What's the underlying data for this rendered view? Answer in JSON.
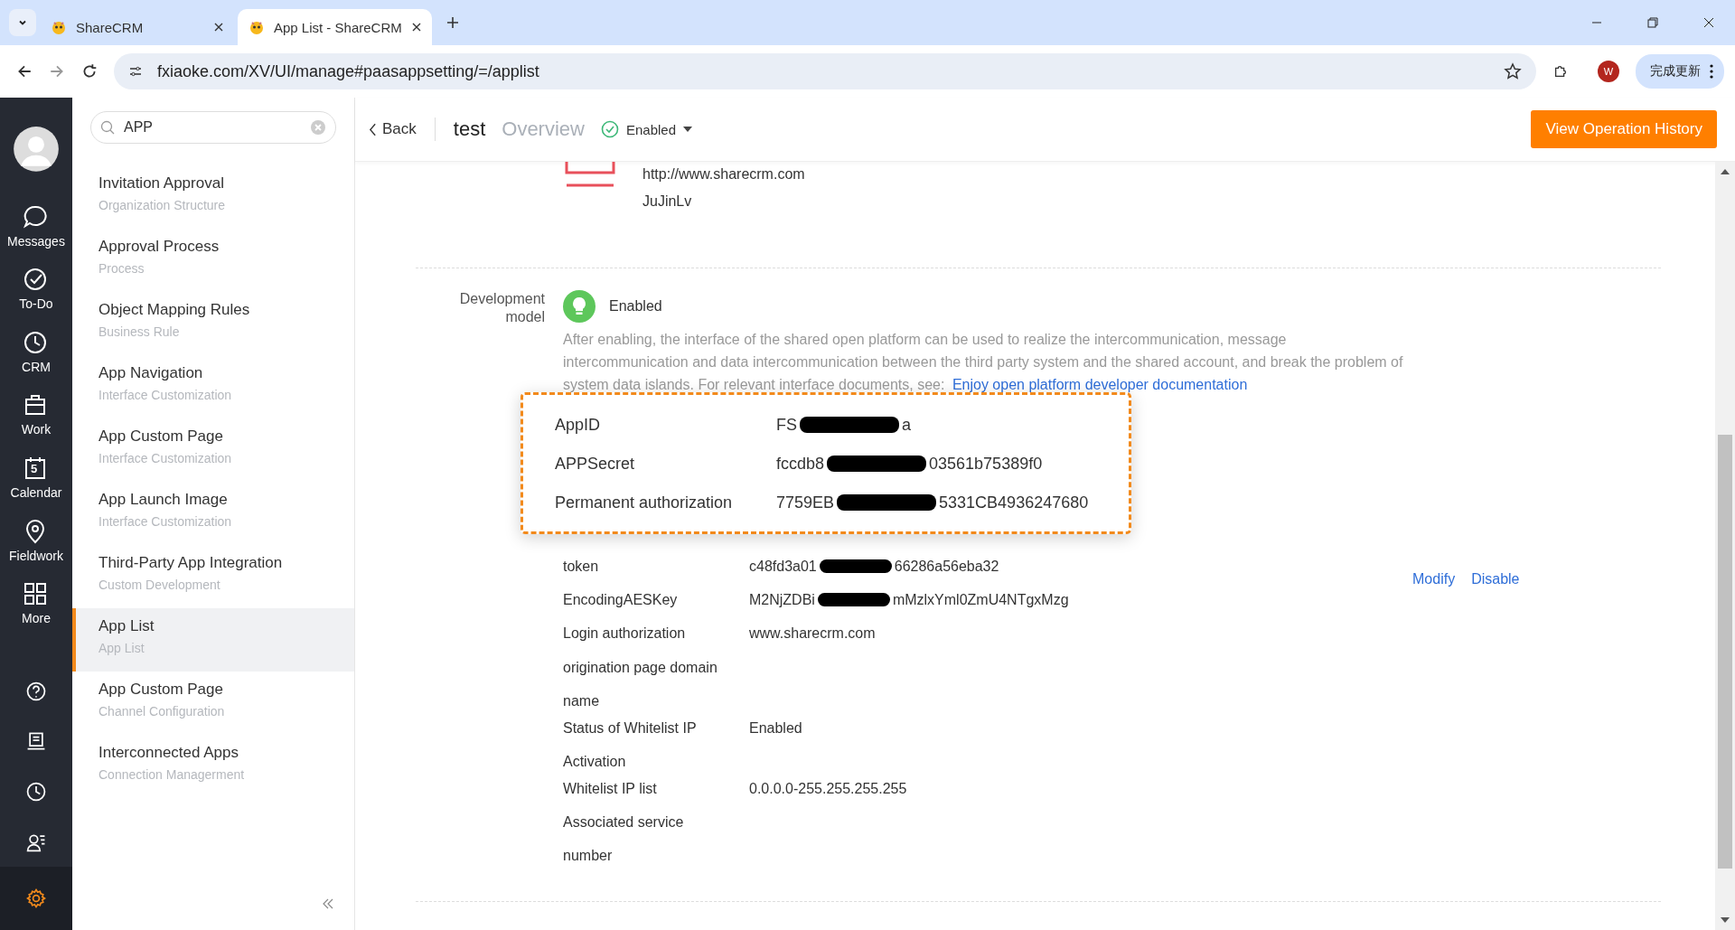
{
  "browser": {
    "tabs": [
      {
        "title": "ShareCRM",
        "selected": false
      },
      {
        "title": "App List - ShareCRM",
        "selected": true
      }
    ],
    "url": "fxiaoke.com/XV/UI/manage#paasappsetting/=/applist",
    "profile": "W",
    "update_button": "完成更新"
  },
  "nav": {
    "items": [
      {
        "label": "Messages",
        "kind": "chat"
      },
      {
        "label": "To-Do",
        "kind": "check"
      },
      {
        "label": "CRM",
        "kind": "clock"
      },
      {
        "label": "Work",
        "kind": "bag"
      },
      {
        "label": "Calendar",
        "kind": "calendar",
        "badge": "5"
      },
      {
        "label": "Fieldwork",
        "kind": "pin"
      },
      {
        "label": "More",
        "kind": "grid"
      }
    ],
    "bottom": [
      {
        "kind": "help",
        "selected": false
      },
      {
        "kind": "doc",
        "selected": false
      },
      {
        "kind": "clock",
        "selected": false
      },
      {
        "kind": "contact",
        "selected": false
      },
      {
        "kind": "gear",
        "selected": true
      }
    ]
  },
  "sidebar": {
    "search": "APP",
    "items": [
      {
        "title": "Invitation Approval",
        "subtitle": "Organization Structure",
        "selected": false
      },
      {
        "title": "Approval Process",
        "subtitle": "Process",
        "selected": false
      },
      {
        "title": "Object Mapping Rules",
        "subtitle": "Business Rule",
        "selected": false
      },
      {
        "title": "App Navigation",
        "subtitle": "Interface Customization",
        "selected": false
      },
      {
        "title": "App Custom Page",
        "subtitle": "Interface Customization",
        "selected": false
      },
      {
        "title": "App Launch Image",
        "subtitle": "Interface Customization",
        "selected": false
      },
      {
        "title": "Third-Party App Integration",
        "subtitle": "Custom Development",
        "selected": false
      },
      {
        "title": "App List",
        "subtitle": "App List",
        "selected": true
      },
      {
        "title": "App Custom Page",
        "subtitle": "Channel Configuration",
        "selected": false
      },
      {
        "title": "Interconnected Apps",
        "subtitle": "Connection Managerment",
        "selected": false
      }
    ]
  },
  "header": {
    "back": "Back",
    "title": "test",
    "tab": "Overview",
    "status": "Enabled",
    "history_button": "View Operation History"
  },
  "app_info": {
    "url": "http://www.sharecrm.com",
    "author": "JuJinLv"
  },
  "development": {
    "label": "Development model",
    "status": "Enabled",
    "description": "After enabling, the interface of the shared open platform can be used to realize the intercommunication, message intercommunication and data intercommunication between the third party system and the shared account, and break the problem of system data islands. For relevant interface documents, see:",
    "link": "Enjoy open platform developer documentation"
  },
  "highlight": [
    {
      "label": "AppID",
      "value_parts": [
        "FS",
        "a"
      ]
    },
    {
      "label": "APPSecret",
      "value_parts": [
        "fccdb8",
        "03561b75389f0"
      ]
    },
    {
      "label": "Permanent authorization",
      "value_parts": [
        "7759EB",
        "5331CB4936247680"
      ]
    }
  ],
  "fields": [
    {
      "label": "token",
      "value_parts": [
        "c48fd3a01",
        "66286a56eba32"
      ]
    },
    {
      "label": "EncodingAESKey",
      "value_parts": [
        "M2NjZDBi",
        "mMzlxYml0ZmU4NTgxMzg"
      ]
    },
    {
      "label": "Login authorization origination page domain name",
      "value_parts": [
        "www.sharecrm.com"
      ]
    },
    {
      "label": "Status of Whitelist IP Activation",
      "value_parts": [
        "Enabled"
      ]
    },
    {
      "label": "Whitelist IP list",
      "value_parts": [
        "0.0.0.0-255.255.255.255"
      ]
    },
    {
      "label": "Associated service number"
    }
  ],
  "actions": [
    "Modify",
    "Disable"
  ]
}
